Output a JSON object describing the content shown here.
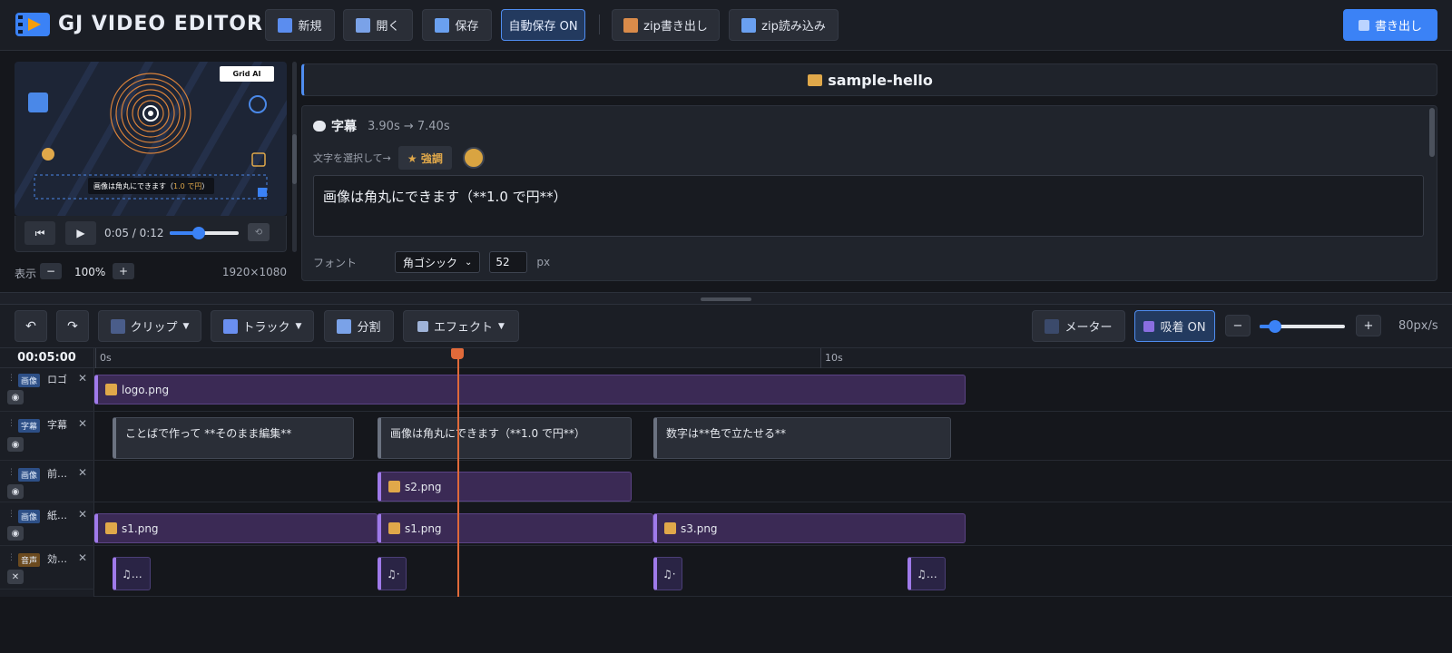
{
  "app": {
    "title": "GJ VIDEO EDITOR"
  },
  "header_buttons": [
    {
      "label": "新規",
      "icon": "new-file-icon"
    },
    {
      "label": "開く",
      "icon": "open-folder-icon"
    },
    {
      "label": "保存",
      "icon": "save-icon"
    },
    {
      "label": "自動保存 ON",
      "icon": ""
    },
    {
      "label": "zip書き出し",
      "icon": "zip-export-icon"
    },
    {
      "label": "zip読み込み",
      "icon": "zip-import-icon"
    }
  ],
  "export_button": {
    "label": "書き出し",
    "icon": "magic-wand-icon"
  },
  "preview": {
    "brand": "Grid AI",
    "caption_plain": "画像は角丸にできます（",
    "caption_highlight": "1.0 で円",
    "caption_end": "）",
    "time": "0:05 / 0:12",
    "progress": 0.42,
    "display_label": "表示",
    "zoom": "100%",
    "minus": "−",
    "plus": "+",
    "resolution": "1920×1080"
  },
  "project": {
    "name": "sample-hello",
    "icon": "folder-icon"
  },
  "editor": {
    "section_icon": "speech-bubble-icon",
    "section": "字幕",
    "range": "3.90s → 7.40s",
    "select_hint": "文字を選択して→",
    "emphasis": "★ 強調",
    "emphasis_color": "#d9a441",
    "text": "画像は角丸にできます（**1.0 で円**）",
    "font_label": "フォント",
    "font_value": "角ゴシック",
    "size_value": "52",
    "size_unit": "px"
  },
  "toolbar": {
    "undo_icon": "undo-icon",
    "redo_icon": "redo-icon",
    "clip": "クリップ",
    "track": "トラック",
    "split": "分割",
    "effect": "エフェクト",
    "meter": "メーター",
    "snap": "吸着 ON",
    "zoom_minus": "−",
    "zoom_plus": "+",
    "zoom_value": "80px/s",
    "zoom_level": 0.18
  },
  "timeline": {
    "current_time": "00:05:00",
    "ruler_labels": [
      "0s",
      "10s"
    ],
    "tracks": [
      {
        "type": "画像",
        "name": "ロゴ",
        "visible_icon": "eye-icon"
      },
      {
        "type": "字幕",
        "name": "字幕",
        "visible_icon": "eye-icon"
      },
      {
        "type": "画像",
        "name": "前…",
        "visible_icon": "eye-icon"
      },
      {
        "type": "画像",
        "name": "紙…",
        "visible_icon": "eye-icon"
      },
      {
        "type": "音声",
        "name": "効…",
        "visible_icon": "speaker-muted-icon"
      }
    ],
    "clips": {
      "logo": "logo.png",
      "sub1": "ことばで作って **そのまま編集**",
      "sub2": "画像は角丸にできます（**1.0 で円**）",
      "sub3": "数字は**色で立たせる**",
      "s2": "s2.png",
      "s1a": "s1.png",
      "s1b": "s1.png",
      "s3": "s3.png",
      "aud1": "♫…",
      "aud2": "♫·",
      "aud3": "♫·",
      "aud4": "♫…"
    },
    "close_glyph": "✕"
  },
  "colors": {
    "accent": "#4f8df0",
    "playhead": "#e06a3a",
    "clip_image": "#3b2a55",
    "clip_text": "#2a2e37"
  }
}
